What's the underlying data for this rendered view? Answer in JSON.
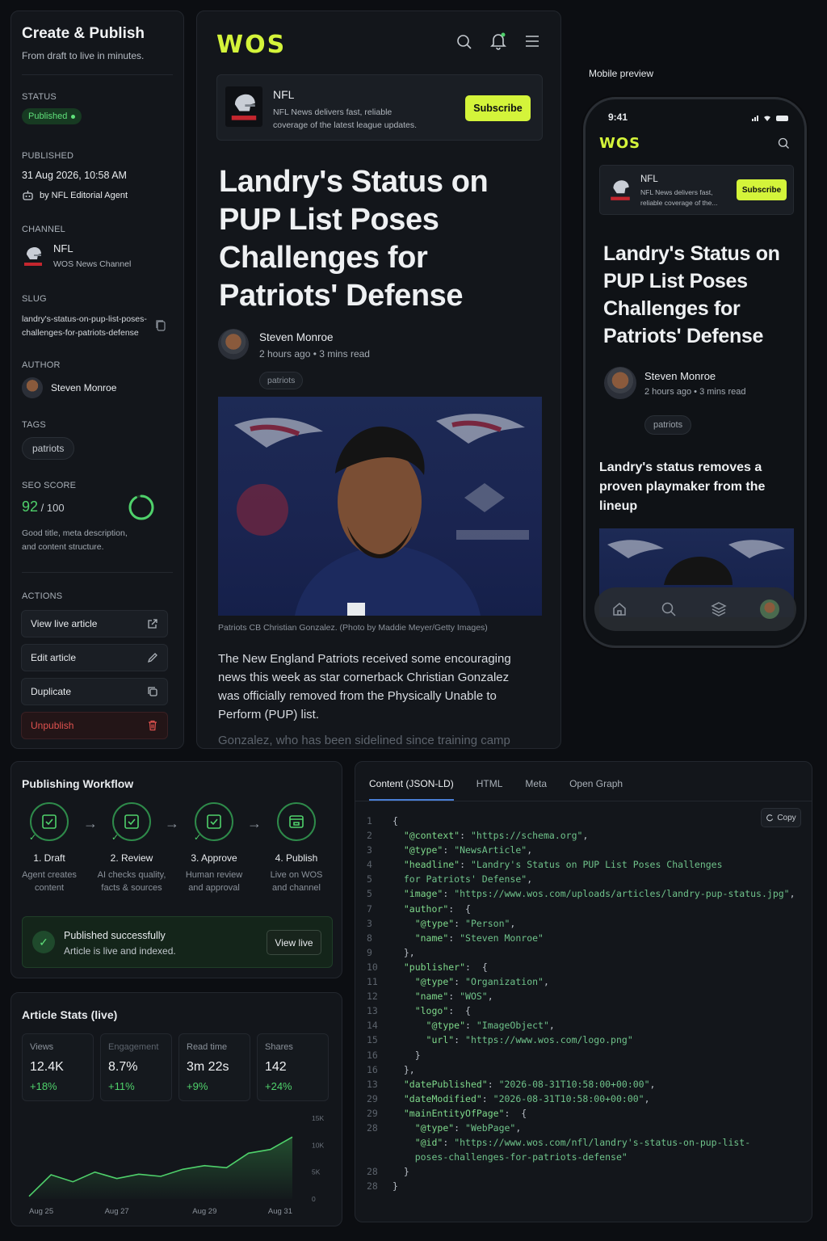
{
  "sidebar": {
    "title": "Create & Publish",
    "subtitle": "From draft to live in minutes.",
    "status_label": "STATUS",
    "status_value": "Published",
    "published_label": "PUBLISHED",
    "published_value": "31 Aug 2026, 10:58 AM",
    "published_by": "by NFL Editorial Agent",
    "channel_label": "CHANNEL",
    "channel_name": "NFL",
    "channel_sub": "WOS News Channel",
    "slug_label": "SLUG",
    "slug_line1": "landry's-status-on-pup-list-poses-",
    "slug_line2": "challenges-for-patriots-defense",
    "author_label": "AUTHOR",
    "author_name": "Steven Monroe",
    "tags_label": "TAGS",
    "tag": "patriots",
    "seo_label": "SEO SCORE",
    "seo_score": "92",
    "seo_total": "/ 100",
    "seo_score_fraction": 0.92,
    "seo_desc1": "Good title, meta description,",
    "seo_desc2": "and content structure.",
    "actions_label": "ACTIONS",
    "actions": [
      "View live article",
      "Edit article",
      "Duplicate",
      "Unpublish"
    ]
  },
  "article": {
    "logo": "WOS",
    "channel_name": "NFL",
    "channel_desc1": "NFL News delivers fast, reliable",
    "channel_desc2": "coverage of the latest league updates.",
    "subscribe": "Subscribe",
    "title_lines": [
      "Landry's Status on",
      "PUP List Poses",
      "Challenges for",
      "Patriots' Defense"
    ],
    "author": "Steven Monroe",
    "time": "2 hours ago",
    "read": "3 mins read",
    "tag": "patriots",
    "caption": "Patriots CB Christian Gonzalez. (Photo by Maddie Meyer/Getty Images)",
    "body1": "The New England Patriots received some encouraging",
    "body2": "news this week as star cornerback Christian Gonzalez",
    "body3": "was officially removed from the Physically Unable to",
    "body4": "Perform (PUP) list.",
    "body5": "Gonzalez, who has been sidelined since training camp"
  },
  "mobile": {
    "label": "Mobile preview",
    "time": "9:41",
    "channel_name": "NFL",
    "channel_desc1": "NFL News delivers fast,",
    "channel_desc2": "reliable coverage of the...",
    "subscribe": "Subscribe",
    "title_lines": [
      "Landry's Status on",
      "PUP List Poses",
      "Challenges for",
      "Patriots' Defense"
    ],
    "author": "Steven Monroe",
    "meta": "2 hours ago • 3 mins read",
    "tag": "patriots",
    "subhead1": "Landry's status removes a",
    "subhead2": "proven playmaker from the",
    "subhead3": "lineup"
  },
  "workflow": {
    "title": "Publishing Workflow",
    "steps": [
      {
        "title": "1. Draft",
        "d1": "Agent creates",
        "d2": "content"
      },
      {
        "title": "2. Review",
        "d1": "AI checks quality,",
        "d2": "facts & sources"
      },
      {
        "title": "3. Approve",
        "d1": "Human review",
        "d2": "and approval"
      },
      {
        "title": "4. Publish",
        "d1": "Live on WOS",
        "d2": "and channel"
      }
    ],
    "success_title": "Published successfully",
    "success_sub": "Article is live and indexed.",
    "view_live": "View live"
  },
  "stats": {
    "title": "Article Stats (live)",
    "cards": [
      {
        "k": "Views",
        "v": "12.4K",
        "c": "+18%"
      },
      {
        "k": "Engagement",
        "v": "8.7%",
        "c": "+11%"
      },
      {
        "k": "Read time",
        "v": "3m 22s",
        "c": "+9%"
      },
      {
        "k": "Shares",
        "v": "142",
        "c": "+24%"
      }
    ],
    "y_ticks": [
      "15K",
      "10K",
      "5K",
      "0"
    ],
    "x_ticks": [
      "Aug 25",
      "Aug 27",
      "Aug 29",
      "Aug 31"
    ]
  },
  "chart_data": {
    "type": "area",
    "x": [
      "Aug 25",
      "Aug 27",
      "Aug 29",
      "Aug 31"
    ],
    "series": [
      {
        "values": [
          500,
          4500,
          3200,
          5000,
          3800,
          4600,
          4200,
          5500,
          6200,
          5800,
          8500,
          9200,
          11500
        ]
      }
    ],
    "ylim": [
      0,
      15000
    ],
    "grid": false
  },
  "code": {
    "tabs": [
      "Content (JSON-LD)",
      "HTML",
      "Meta",
      "Open Graph"
    ],
    "copy": "Copy",
    "lines": [
      {
        "n": "1",
        "t": "{"
      },
      {
        "n": "2",
        "k": "\"@context\"",
        "v": "\"https://schema.org\"",
        "e": ",",
        "i": 1
      },
      {
        "n": "3",
        "k": "\"@type\"",
        "v": "\"NewsArticle\"",
        "e": ",",
        "i": 1
      },
      {
        "n": "4",
        "k": "\"headline\"",
        "v": "\"Landry's Status on PUP List Poses Challenges",
        "i": 1
      },
      {
        "n": "5",
        "v": "for Patriots' Defense\"",
        "e": ",",
        "i": 1
      },
      {
        "n": "5",
        "k": "\"image\"",
        "v": "\"https://www.wos.com/uploads/articles/landry-pup-status.jpg\"",
        "e": ",",
        "i": 1
      },
      {
        "n": "7",
        "k": "\"author\"",
        "e": " {",
        "i": 1
      },
      {
        "n": "3",
        "k": "\"@type\"",
        "v": "\"Person\"",
        "e": ",",
        "i": 2
      },
      {
        "n": "8",
        "k": "\"name\"",
        "v": "\"Steven Monroe\"",
        "i": 2
      },
      {
        "n": "9",
        "t": "},",
        "i": 1
      },
      {
        "n": "10",
        "k": "\"publisher\"",
        "e": " {",
        "i": 1
      },
      {
        "n": "11",
        "k": "\"@type\"",
        "v": "\"Organization\"",
        "e": ",",
        "i": 2
      },
      {
        "n": "12",
        "k": "\"name\"",
        "v": "\"WOS\"",
        "e": ",",
        "i": 2
      },
      {
        "n": "13",
        "k": "\"logo\"",
        "e": " {",
        "i": 2
      },
      {
        "n": "14",
        "k": "\"@type\"",
        "v": "\"ImageObject\"",
        "e": ",",
        "i": 3
      },
      {
        "n": "15",
        "k": "\"url\"",
        "v": "\"https://www.wos.com/logo.png\"",
        "i": 3
      },
      {
        "n": "16",
        "t": "}",
        "i": 2
      },
      {
        "n": "16",
        "t": "},",
        "i": 1
      },
      {
        "n": "13",
        "k": "\"datePublished\"",
        "v": "\"2026-08-31T10:58:00+00:00\"",
        "e": ",",
        "i": 1
      },
      {
        "n": "29",
        "k": "\"dateModified\"",
        "v": "\"2026-08-31T10:58:00+00:00\"",
        "e": ",",
        "i": 1
      },
      {
        "n": "29",
        "k": "\"mainEntityOfPage\"",
        "e": " {",
        "i": 1
      },
      {
        "n": "28",
        "k": "\"@type\"",
        "v": "\"WebPage\"",
        "e": ",",
        "i": 2
      },
      {
        "n": "",
        "k": "\"@id\"",
        "v": "\"https://www.wos.com/nfl/landry's-status-on-pup-list-",
        "i": 2
      },
      {
        "n": "",
        "v": "poses-challenges-for-patriots-defense\"",
        "i": 2
      },
      {
        "n": "28",
        "t": "}",
        "i": 1
      },
      {
        "n": "28",
        "t": "}"
      }
    ]
  },
  "colors": {
    "accent": "#d4f43a",
    "success": "#4fd16b",
    "danger": "#e0524f",
    "bg": "#0c0e12"
  }
}
